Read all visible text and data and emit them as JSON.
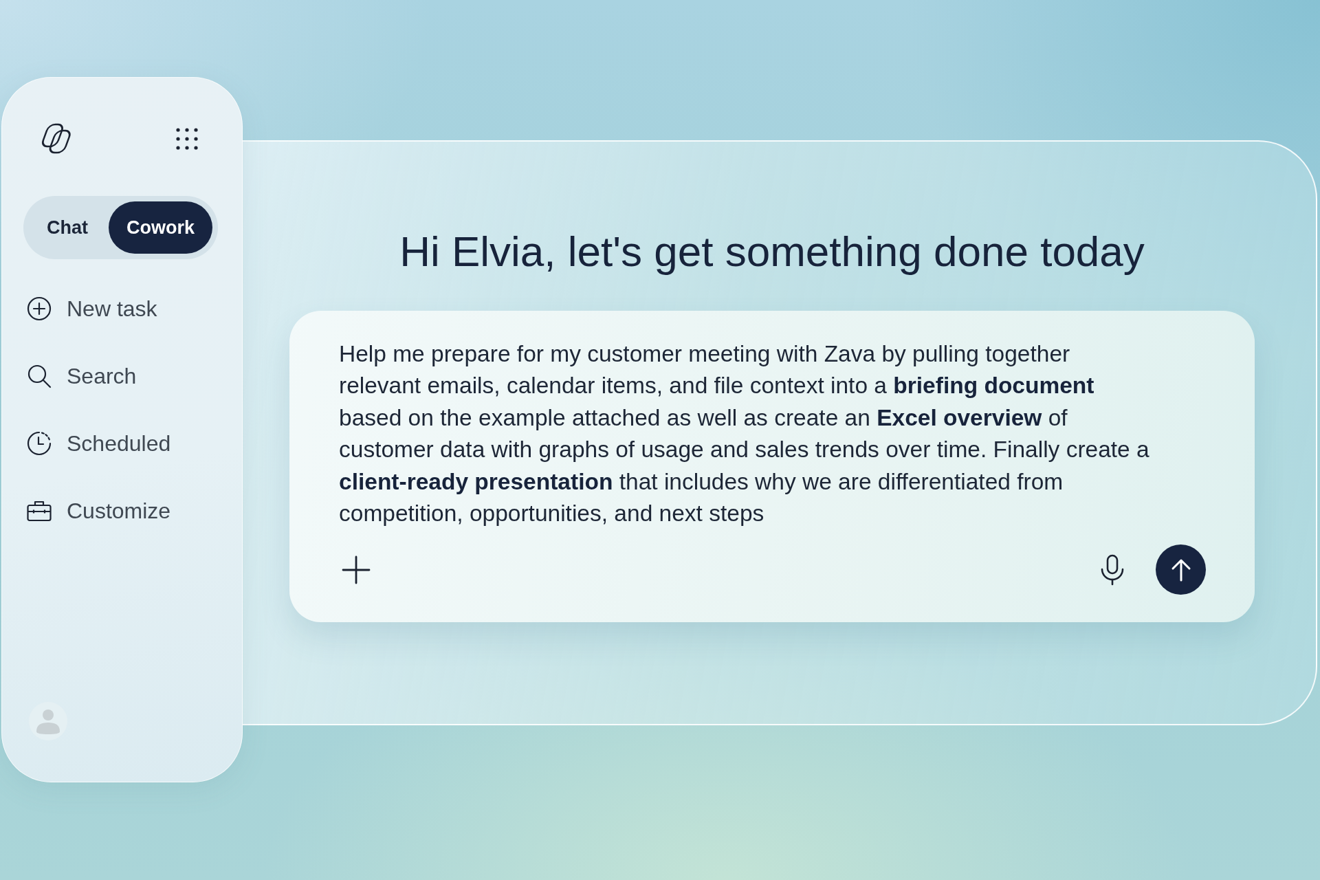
{
  "sidebar": {
    "mode_toggle": [
      {
        "label": "Chat",
        "selected": false
      },
      {
        "label": "Cowork",
        "selected": true
      }
    ],
    "items": [
      {
        "label": "New task"
      },
      {
        "label": "Search"
      },
      {
        "label": "Scheduled"
      },
      {
        "label": "Customize"
      }
    ]
  },
  "main": {
    "greeting": "Hi Elvia, let's get something done today",
    "prompt": {
      "value": "Help me prepare for my customer meeting with Zava by pulling together relevant emails, calendar items, and file context into a **briefing document** based on the example attached as well as create an **Excel overview** of customer data with graphs of usage and sales trends over time. Finally create a **client-ready presentation** that includes why we are differentiated from competition, opportunities, and next steps"
    }
  }
}
